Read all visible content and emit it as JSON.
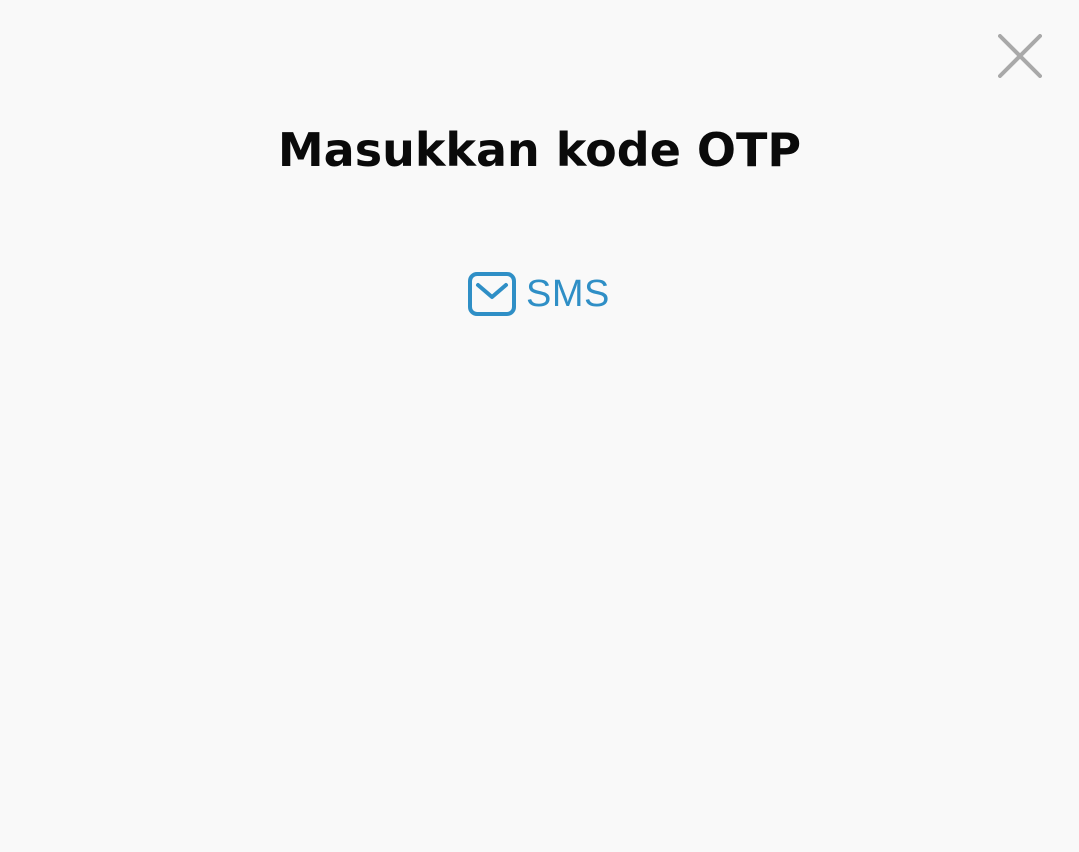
{
  "dialog": {
    "title": "Masukkan kode OTP",
    "close_icon": "close-icon"
  },
  "methods": [
    {
      "label": "SMS",
      "icon": "envelope-icon"
    }
  ],
  "colors": {
    "background": "#f9f9f9",
    "title": "#0a0a0a",
    "accent": "#2f8fc6",
    "close_icon": "#a9a9a9"
  }
}
